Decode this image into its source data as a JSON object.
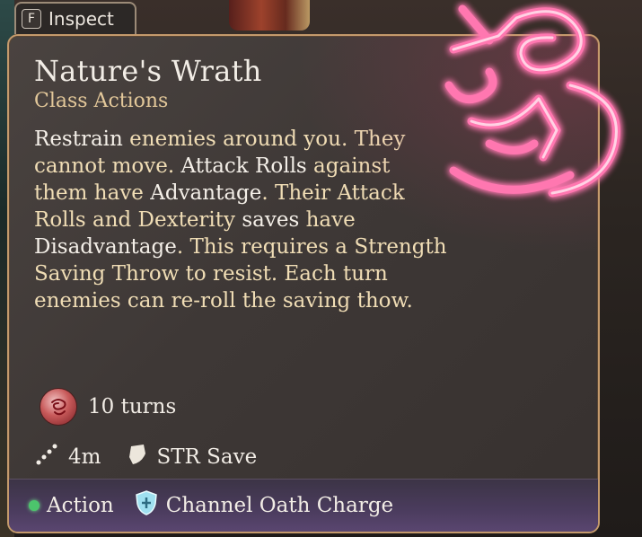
{
  "inspect": {
    "key": "F",
    "label": "Inspect"
  },
  "tooltip": {
    "title": "Nature's Wrath",
    "subtitle": "Class Actions",
    "description": [
      {
        "t": "Restrain",
        "c": "w"
      },
      {
        "t": " enemies around you. They cannot move. ",
        "c": "h"
      },
      {
        "t": "Attack Rolls",
        "c": "w"
      },
      {
        "t": " against them have ",
        "c": "h"
      },
      {
        "t": "Advantage",
        "c": "w"
      },
      {
        "t": ". Their Attack Rolls and Dexterity ",
        "c": "h"
      },
      {
        "t": "saves",
        "c": "w"
      },
      {
        "t": " have ",
        "c": "h"
      },
      {
        "t": "Disadvantage",
        "c": "w"
      },
      {
        "t": ". This requires a Strength Saving Throw to resist. Each turn enemies can re-roll the saving thow.",
        "c": "h"
      }
    ],
    "duration": "10 turns",
    "range": "4m",
    "save": "STR Save",
    "resources": [
      {
        "label": "Action",
        "icon": "green-dot-icon"
      },
      {
        "label": "Channel Oath Charge",
        "icon": "shield-cross-icon"
      }
    ]
  },
  "colors": {
    "title": "#f2ede6",
    "subtitle": "#e3c89a",
    "highlight": "#e9d6b0",
    "border": "#c49a6c",
    "rune_glow": "#ff6ea8",
    "action_dot": "#4cc46c",
    "footer": "#4b3c5e"
  }
}
